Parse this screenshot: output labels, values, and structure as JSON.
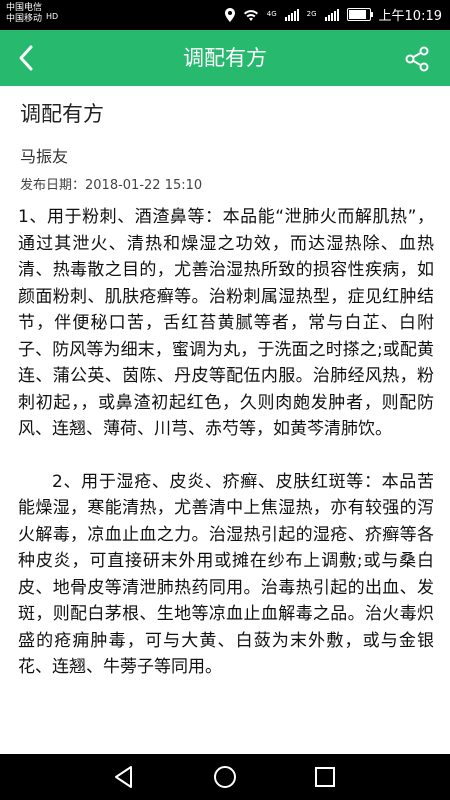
{
  "status_bar": {
    "carrier_1": "中国电信",
    "carrier_2": "中国移动",
    "hd_label": "HD",
    "net_1": "4G",
    "net_2": "2G",
    "time": "上午10:19"
  },
  "app_bar": {
    "title": "调配有方",
    "back_icon": "chevron-left-icon",
    "share_icon": "share-icon",
    "color": "#27b96e"
  },
  "article": {
    "title": "调配有方",
    "author": "马振友",
    "date_label": "发布日期：",
    "date": "2018-01-22 15:10",
    "paragraph_1": "1、用于粉刺、酒渣鼻等：本品能“泄肺火而解肌热”，通过其泄火、清热和燥湿之功效，而达湿热除、血热清、热毒散之目的，尤善治湿热所致的损容性疾病，如颜面粉刺、肌肤疮癣等。治粉刺属湿热型，症见红肿结节，伴便秘口苦，舌红苔黄腻等者，常与白芷、白附子、防风等为细末，蜜调为丸，于洗面之时搽之;或配黄连、蒲公英、茵陈、丹皮等配伍内服。治肺经风热，粉刺初起，，或鼻渣初起红色，久则肉皰发肿者，则配防风、连翘、薄荷、川芎、赤芍等，如黄芩清肺饮。",
    "paragraph_2": "2、用于湿疮、皮炎、疥癣、皮肤红斑等：本品苦能燥湿，寒能清热，尤善清中上焦湿热，亦有较强的泻火解毒，凉血止血之力。治湿热引起的湿疮、疥癣等各种皮炎，可直接研末外用或摊在纱布上调敷;或与桑白皮、地骨皮等清泄肺热药同用。治毒热引起的出血、发斑，则配白茅根、生地等凉血止血解毒之品。治火毒炽盛的疮痈肿毒，可与大黄、白蔹为末外敷，或与金银花、连翘、牛蒡子等同用。"
  },
  "nav_bar": {
    "back_icon": "triangle-back-icon",
    "home_icon": "circle-home-icon",
    "recents_icon": "square-recents-icon"
  }
}
